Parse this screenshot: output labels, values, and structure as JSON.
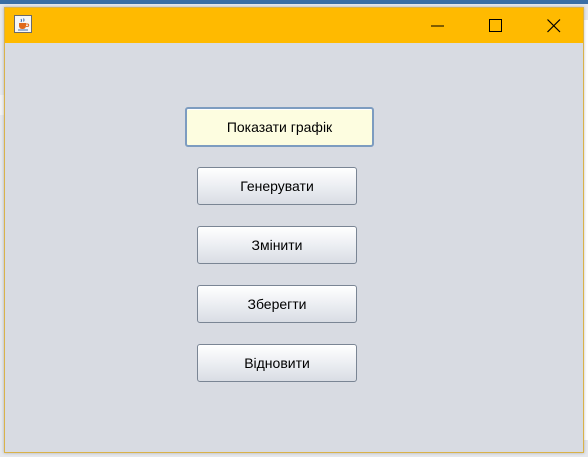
{
  "window": {
    "title": "",
    "titlebar_color": "#ffba00",
    "content_bg": "#d8dbe2",
    "controls": {
      "minimize_icon": "minimize-icon",
      "maximize_icon": "maximize-icon",
      "close_icon": "close-icon"
    },
    "app_icon": "java-cup-icon"
  },
  "buttons": {
    "show_chart": "Показати графік",
    "generate": "Генерувати",
    "change": "Змінити",
    "save": "Зберегти",
    "restore": "Відновити"
  },
  "colors": {
    "focused_button_bg": "#fdfde0",
    "focused_button_border": "#7d9cc0"
  }
}
